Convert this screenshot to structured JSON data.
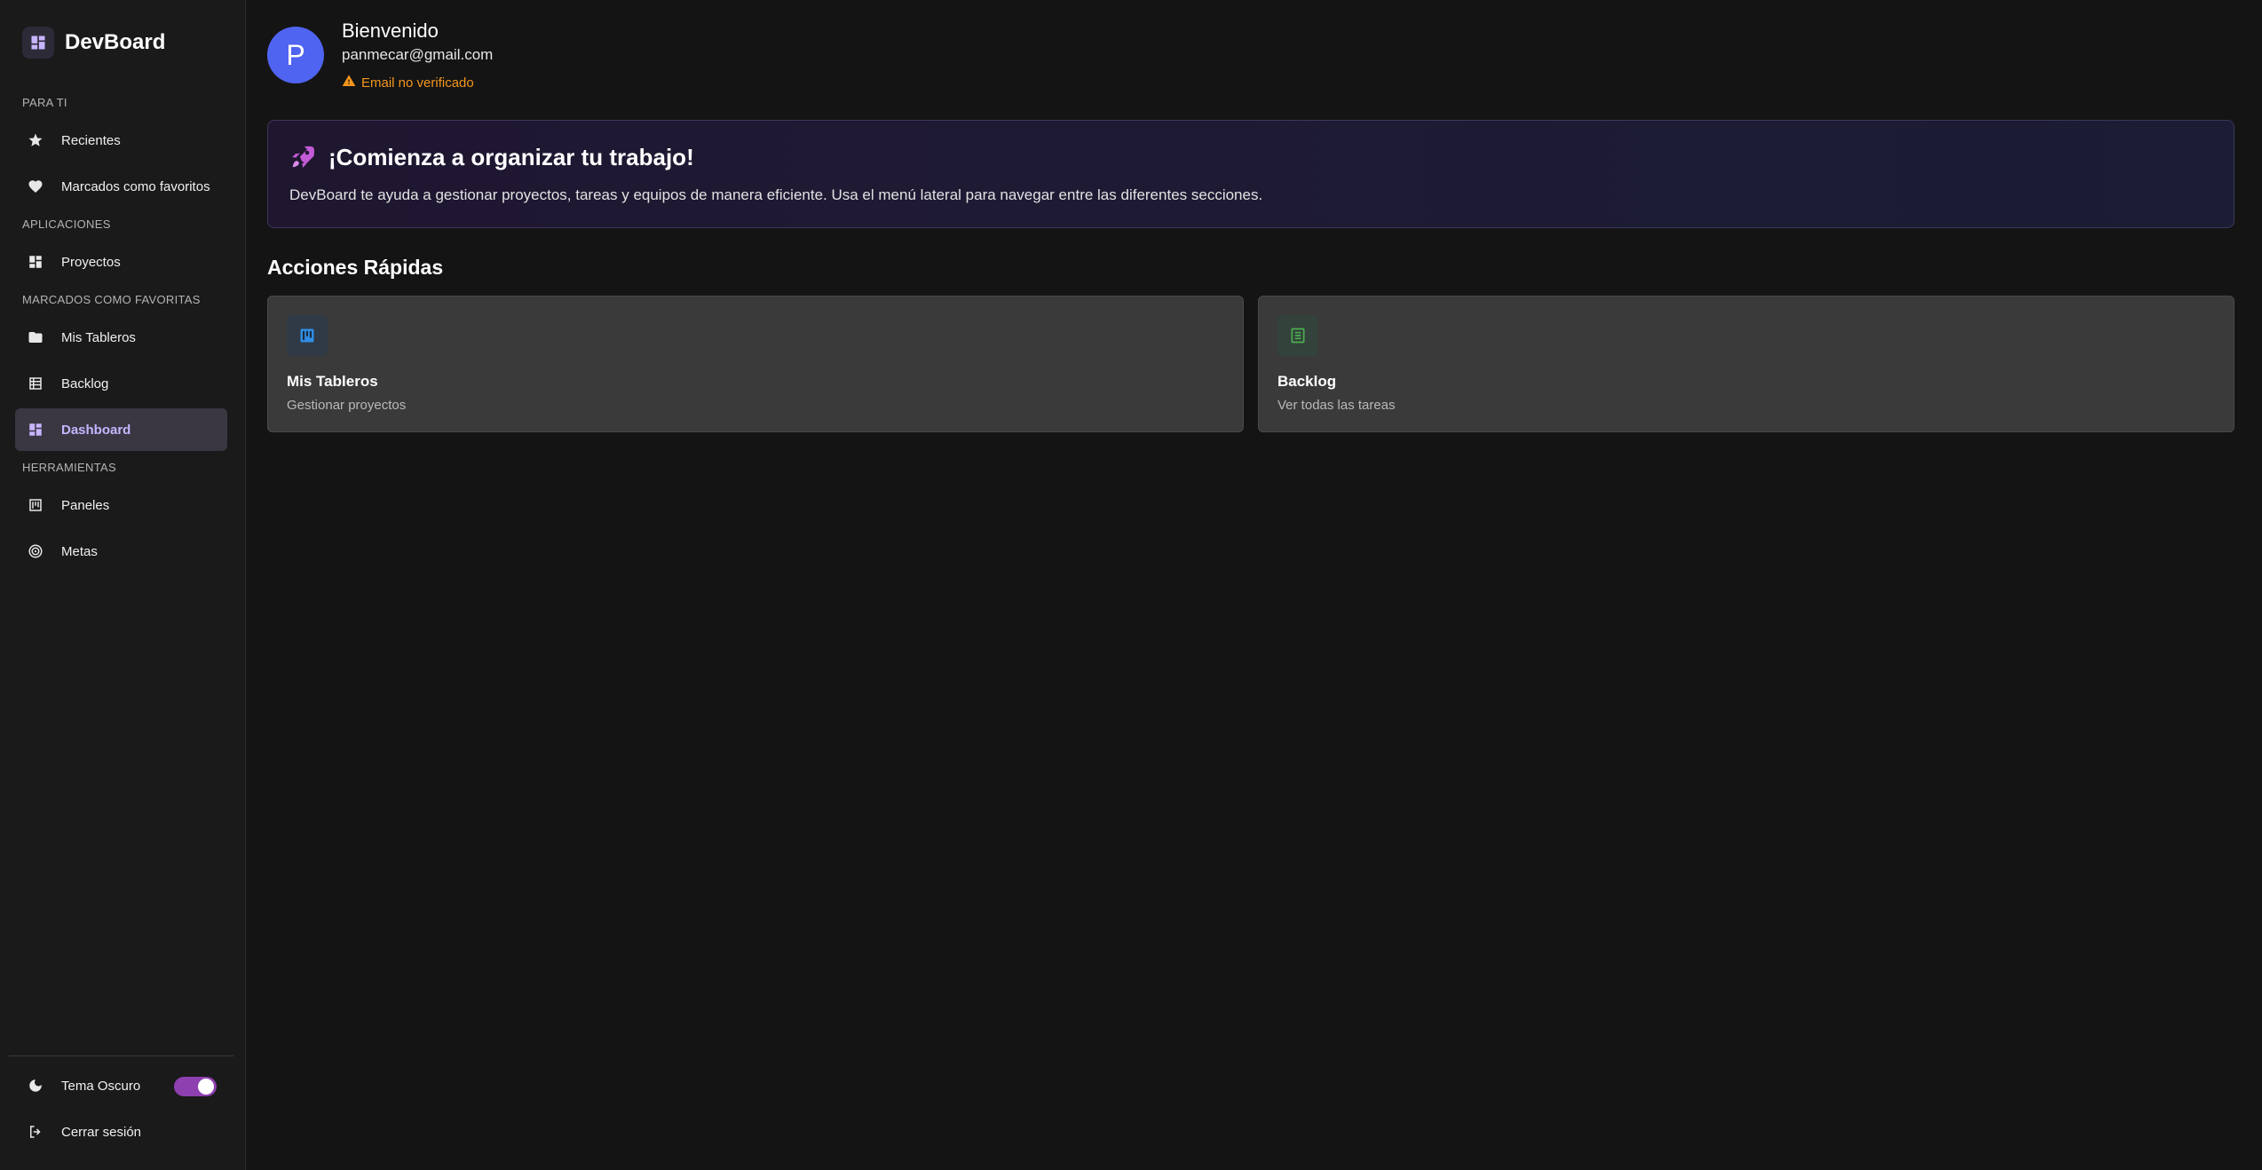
{
  "sidebar": {
    "brand": "DevBoard",
    "sections": {
      "para_ti": "PARA TI",
      "aplicaciones": "APLICACIONES",
      "favoritas": "MARCADOS COMO FAVORITAS",
      "herramientas": "HERRAMIENTAS"
    },
    "items": {
      "recientes": "Recientes",
      "favoritos": "Marcados como favoritos",
      "proyectos": "Proyectos",
      "mis_tableros": "Mis Tableros",
      "backlog": "Backlog",
      "dashboard": "Dashboard",
      "paneles": "Paneles",
      "metas": "Metas"
    },
    "footer": {
      "tema_oscuro": "Tema Oscuro",
      "tema_oscuro_on": true,
      "cerrar_sesion": "Cerrar sesión"
    },
    "active_item": "dashboard",
    "accent_color": "#c7b5ff"
  },
  "user": {
    "initial": "P",
    "greeting": "Bienvenido",
    "email": "panmecar@gmail.com",
    "warning": "Email no verificado",
    "warning_color": "#f5961d"
  },
  "banner": {
    "title": "¡Comienza a organizar tu trabajo!",
    "text": "DevBoard te ayuda a gestionar proyectos, tareas y equipos de manera eficiente. Usa el menú lateral para navegar entre las diferentes secciones."
  },
  "quick_actions": {
    "title": "Acciones Rápidas",
    "cards": [
      {
        "title": "Mis Tableros",
        "subtitle": "Gestionar proyectos",
        "icon": "board-icon",
        "color": "#2f8de4"
      },
      {
        "title": "Backlog",
        "subtitle": "Ver todas las tareas",
        "icon": "list-icon",
        "color": "#4caf50"
      }
    ]
  }
}
